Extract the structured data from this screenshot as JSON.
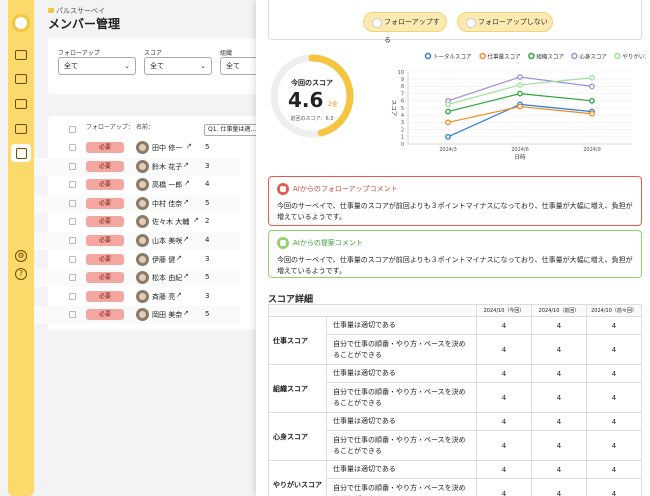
{
  "sidebar": {
    "icons": [
      "logo-icon",
      "survey-icon",
      "users-icon",
      "group-icon",
      "chart-icon",
      "members-icon",
      "settings-icon",
      "help-icon"
    ]
  },
  "page": {
    "breadcrumb": "パルスサーベイ",
    "title": "メンバー管理"
  },
  "filters": {
    "followup_label": "フォローアップ",
    "followup_value": "全て",
    "score_label": "スコア",
    "score_value": "全て",
    "org_label": "組織",
    "org_value": "全て"
  },
  "member_table": {
    "col_followup": "フォローアップ：",
    "col_name": "名前：",
    "col_question": "Q1. 仕事量は適...",
    "rows": [
      {
        "badge": "必要",
        "name": "田中 修一",
        "score": "5"
      },
      {
        "badge": "必要",
        "name": "鈴木 花子",
        "score": "3"
      },
      {
        "badge": "必要",
        "name": "高橋 一郎",
        "score": "4"
      },
      {
        "badge": "必要",
        "name": "中村 佳奈",
        "score": "5"
      },
      {
        "badge": "必要",
        "name": "佐々木 大輔",
        "score": "2"
      },
      {
        "badge": "必要",
        "name": "山本 美咲",
        "score": "4"
      },
      {
        "badge": "必要",
        "name": "伊藤 健",
        "score": "3"
      },
      {
        "badge": "必要",
        "name": "松本 由紀",
        "score": "5"
      },
      {
        "badge": "必要",
        "name": "斉藤 亮",
        "score": "3"
      },
      {
        "badge": "必要",
        "name": "岡田 美奈",
        "score": "5"
      }
    ]
  },
  "panel": {
    "followup_button": "フォローアップする",
    "no_followup_button": "フォローアップしない",
    "gauge_label": "今回のスコア",
    "gauge_value": "4.6",
    "gauge_diff": "2全",
    "gauge_prev": "前回のスコア：6.3",
    "gauge_fraction": 0.46,
    "ai_followup_title": "AIからのフォローアップコメント",
    "ai_followup_body": "今回のサーベイで、仕事量のスコアが前回よりも３ポイントマイナスになっており、仕事量が大幅に増え、負担が増えているようです。",
    "ai_suggest_title": "AIからの提案コメント",
    "ai_suggest_body": "今回のサーベイで、仕事量のスコアが前回よりも３ポイントマイナスになっており、仕事量が大幅に増え、負担が増えているようです。",
    "score_detail_title": "スコア詳細"
  },
  "chart_data": {
    "type": "line",
    "categories": [
      "2024/3",
      "2024/6",
      "2024/9"
    ],
    "xlabel": "日時",
    "ylabel": "スコア",
    "ylim": [
      0,
      10
    ],
    "yticks": [
      "0",
      "1",
      "2",
      "3",
      "4",
      "5",
      "6",
      "7",
      "8",
      "9",
      "10"
    ],
    "legend_position": "top",
    "series": [
      {
        "name": "トータルスコア",
        "color": "#2b7bd6",
        "values": [
          1,
          5.5,
          4.5
        ]
      },
      {
        "name": "仕事量スコア",
        "color": "#f08a24",
        "values": [
          3,
          5.2,
          4.2
        ]
      },
      {
        "name": "組織スコア",
        "color": "#2aa63a",
        "values": [
          4.5,
          7,
          6
        ]
      },
      {
        "name": "心身スコア",
        "color": "#9b8fe0",
        "values": [
          6,
          9.3,
          8
        ]
      },
      {
        "name": "やりがいスコア",
        "color": "#9ee29a",
        "values": [
          5.5,
          8.2,
          9.2
        ]
      }
    ]
  },
  "score_detail": {
    "headers": [
      "2024/10（今回）",
      "2024/10（前回）",
      "2024/10（前々回）"
    ],
    "categories": [
      {
        "name": "仕事スコア",
        "items": [
          {
            "text": "仕事量は適切である",
            "values": [
              "4",
              "4",
              "4"
            ]
          },
          {
            "text": "自分で仕事の順番・やり方・ペースを決めることができる",
            "values": [
              "4",
              "4",
              "4"
            ]
          }
        ]
      },
      {
        "name": "組織スコア",
        "items": [
          {
            "text": "仕事量は適切である",
            "values": [
              "4",
              "4",
              "4"
            ]
          },
          {
            "text": "自分で仕事の順番・やり方・ペースを決めることができる",
            "values": [
              "4",
              "4",
              "4"
            ]
          }
        ]
      },
      {
        "name": "心身スコア",
        "items": [
          {
            "text": "仕事量は適切である",
            "values": [
              "4",
              "4",
              "4"
            ]
          },
          {
            "text": "自分で仕事の順番・やり方・ペースを決めることができる",
            "values": [
              "4",
              "4",
              "4"
            ]
          }
        ]
      },
      {
        "name": "やりがいスコア",
        "items": [
          {
            "text": "仕事量は適切である",
            "values": [
              "4",
              "4",
              "4"
            ]
          },
          {
            "text": "自分で仕事の順番・やり方・ペースを決めることができる",
            "values": [
              "4",
              "4",
              "4"
            ]
          }
        ]
      }
    ]
  },
  "colors": {
    "accent": "#f5c542",
    "rail": "#fbd96a",
    "badge": "#f4a7a0",
    "alert_border": "#e85a4f",
    "alert_text": "#d8473c",
    "suggest_border": "#8fd46a",
    "suggest_text": "#3aa23a"
  }
}
